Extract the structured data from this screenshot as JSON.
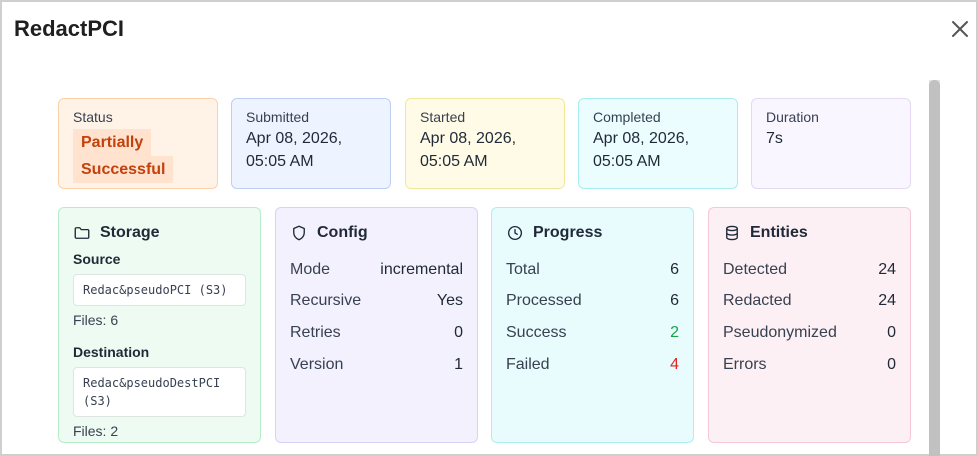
{
  "dialog": {
    "title": "RedactPCI",
    "close_icon": "close-icon"
  },
  "stats": {
    "status": {
      "label": "Status",
      "value_line1": "Partially",
      "value_line2": "Successful",
      "color": "#c2410c"
    },
    "submitted": {
      "label": "Submitted",
      "value_line1": "Apr 08, 2026,",
      "value_line2": "05:05 AM"
    },
    "started": {
      "label": "Started",
      "value_line1": "Apr 08, 2026,",
      "value_line2": "05:05 AM"
    },
    "completed": {
      "label": "Completed",
      "value_line1": "Apr 08, 2026,",
      "value_line2": "05:05 AM"
    },
    "duration": {
      "label": "Duration",
      "value": "7s"
    }
  },
  "storage": {
    "title": "Storage",
    "icon": "folder-icon",
    "source_label": "Source",
    "source_line1": "Redac&pseudoPCI (S3)",
    "source_files": "Files: 6",
    "destination_label": "Destination",
    "destination_line1": "Redac&pseudoDestPCI",
    "destination_line2": "(S3)",
    "destination_files": "Files: 2"
  },
  "config": {
    "title": "Config",
    "icon": "shield-icon",
    "rows": [
      {
        "label": "Mode",
        "value": "incremental"
      },
      {
        "label": "Recursive",
        "value": "Yes"
      },
      {
        "label": "Retries",
        "value": "0"
      },
      {
        "label": "Version",
        "value": "1"
      }
    ]
  },
  "progress": {
    "title": "Progress",
    "icon": "clock-icon",
    "rows": [
      {
        "label": "Total",
        "value": "6"
      },
      {
        "label": "Processed",
        "value": "6"
      },
      {
        "label": "Success",
        "value": "2",
        "color": "#16a34a"
      },
      {
        "label": "Failed",
        "value": "4",
        "color": "#dc2626"
      }
    ]
  },
  "entities": {
    "title": "Entities",
    "icon": "database-icon",
    "rows": [
      {
        "label": "Detected",
        "value": "24"
      },
      {
        "label": "Redacted",
        "value": "24"
      },
      {
        "label": "Pseudonymized",
        "value": "0"
      },
      {
        "label": "Errors",
        "value": "0"
      }
    ]
  }
}
